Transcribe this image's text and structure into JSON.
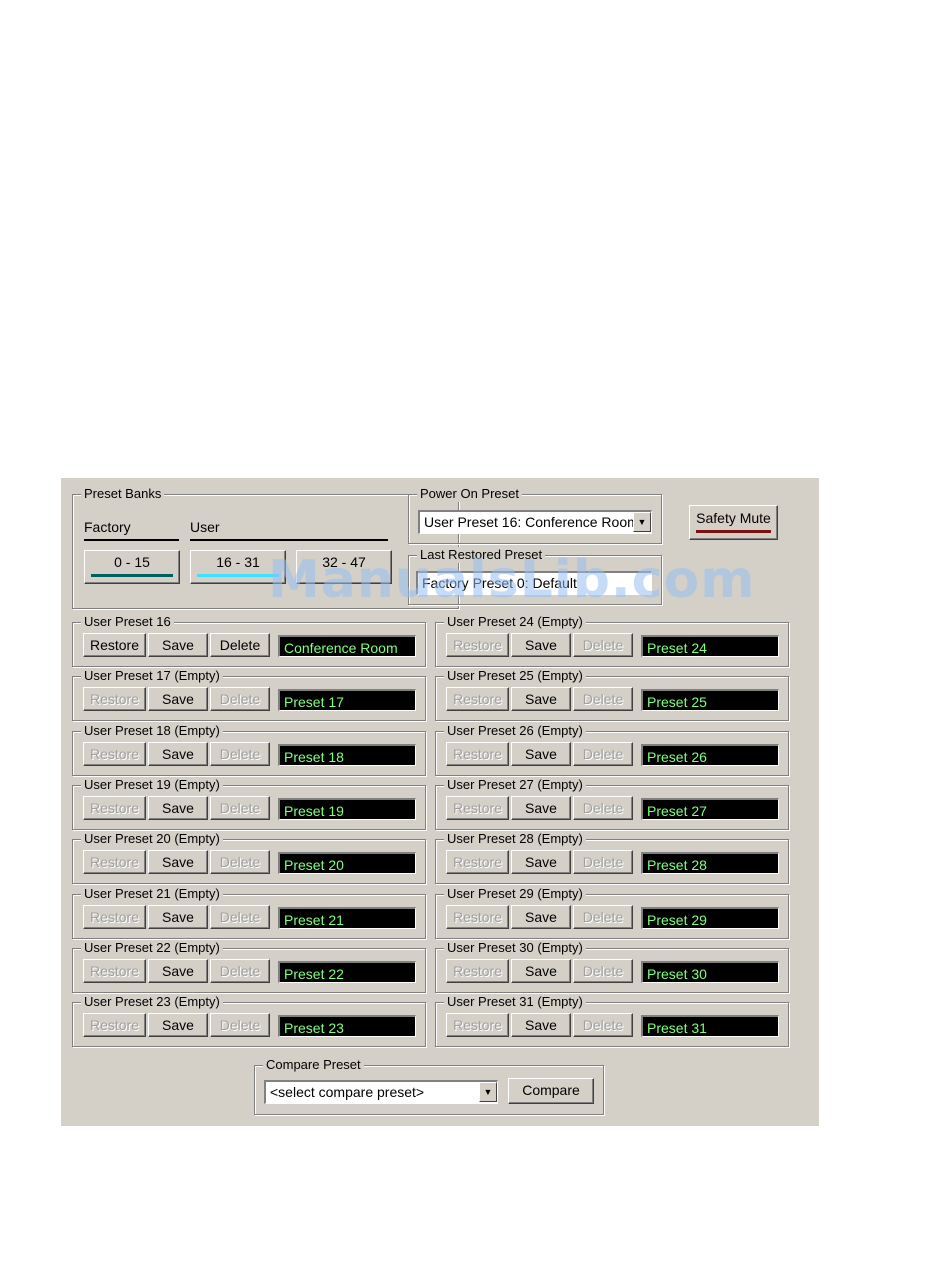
{
  "preset_banks": {
    "title": "Preset Banks",
    "factory_label": "Factory",
    "user_label": "User",
    "buttons": [
      {
        "label": "0 - 15",
        "bar_color": "#006060"
      },
      {
        "label": "16 - 31",
        "bar_color": "#40e0ff"
      },
      {
        "label": "32 - 47",
        "bar_color": "#40e0ff"
      }
    ]
  },
  "power_on": {
    "title": "Power On Preset",
    "value": "User Preset 16: Conference Room"
  },
  "safety_mute": {
    "label": "Safety Mute",
    "bar_color": "#7a1010"
  },
  "last_restored": {
    "title": "Last Restored Preset",
    "value": "Factory Preset 0: Default"
  },
  "watermark": "ManualsLib.com",
  "buttons": {
    "restore": "Restore",
    "save": "Save",
    "delete": "Delete"
  },
  "presets_left": [
    {
      "title": "User Preset 16",
      "name": "Conference Room",
      "empty": false
    },
    {
      "title": "User Preset 17 (Empty)",
      "name": "Preset 17",
      "empty": true
    },
    {
      "title": "User Preset 18 (Empty)",
      "name": "Preset 18",
      "empty": true
    },
    {
      "title": "User Preset 19 (Empty)",
      "name": "Preset 19",
      "empty": true
    },
    {
      "title": "User Preset 20 (Empty)",
      "name": "Preset 20",
      "empty": true
    },
    {
      "title": "User Preset 21 (Empty)",
      "name": "Preset 21",
      "empty": true
    },
    {
      "title": "User Preset 22 (Empty)",
      "name": "Preset 22",
      "empty": true
    },
    {
      "title": "User Preset 23 (Empty)",
      "name": "Preset 23",
      "empty": true
    }
  ],
  "presets_right": [
    {
      "title": "User Preset 24 (Empty)",
      "name": "Preset 24",
      "empty": true
    },
    {
      "title": "User Preset 25 (Empty)",
      "name": "Preset 25",
      "empty": true
    },
    {
      "title": "User Preset 26 (Empty)",
      "name": "Preset 26",
      "empty": true
    },
    {
      "title": "User Preset 27 (Empty)",
      "name": "Preset 27",
      "empty": true
    },
    {
      "title": "User Preset 28 (Empty)",
      "name": "Preset 28",
      "empty": true
    },
    {
      "title": "User Preset 29 (Empty)",
      "name": "Preset 29",
      "empty": true
    },
    {
      "title": "User Preset 30 (Empty)",
      "name": "Preset 30",
      "empty": true
    },
    {
      "title": "User Preset 31 (Empty)",
      "name": "Preset 31",
      "empty": true
    }
  ],
  "compare": {
    "title": "Compare Preset",
    "placeholder": "<select compare preset>",
    "button": "Compare"
  }
}
